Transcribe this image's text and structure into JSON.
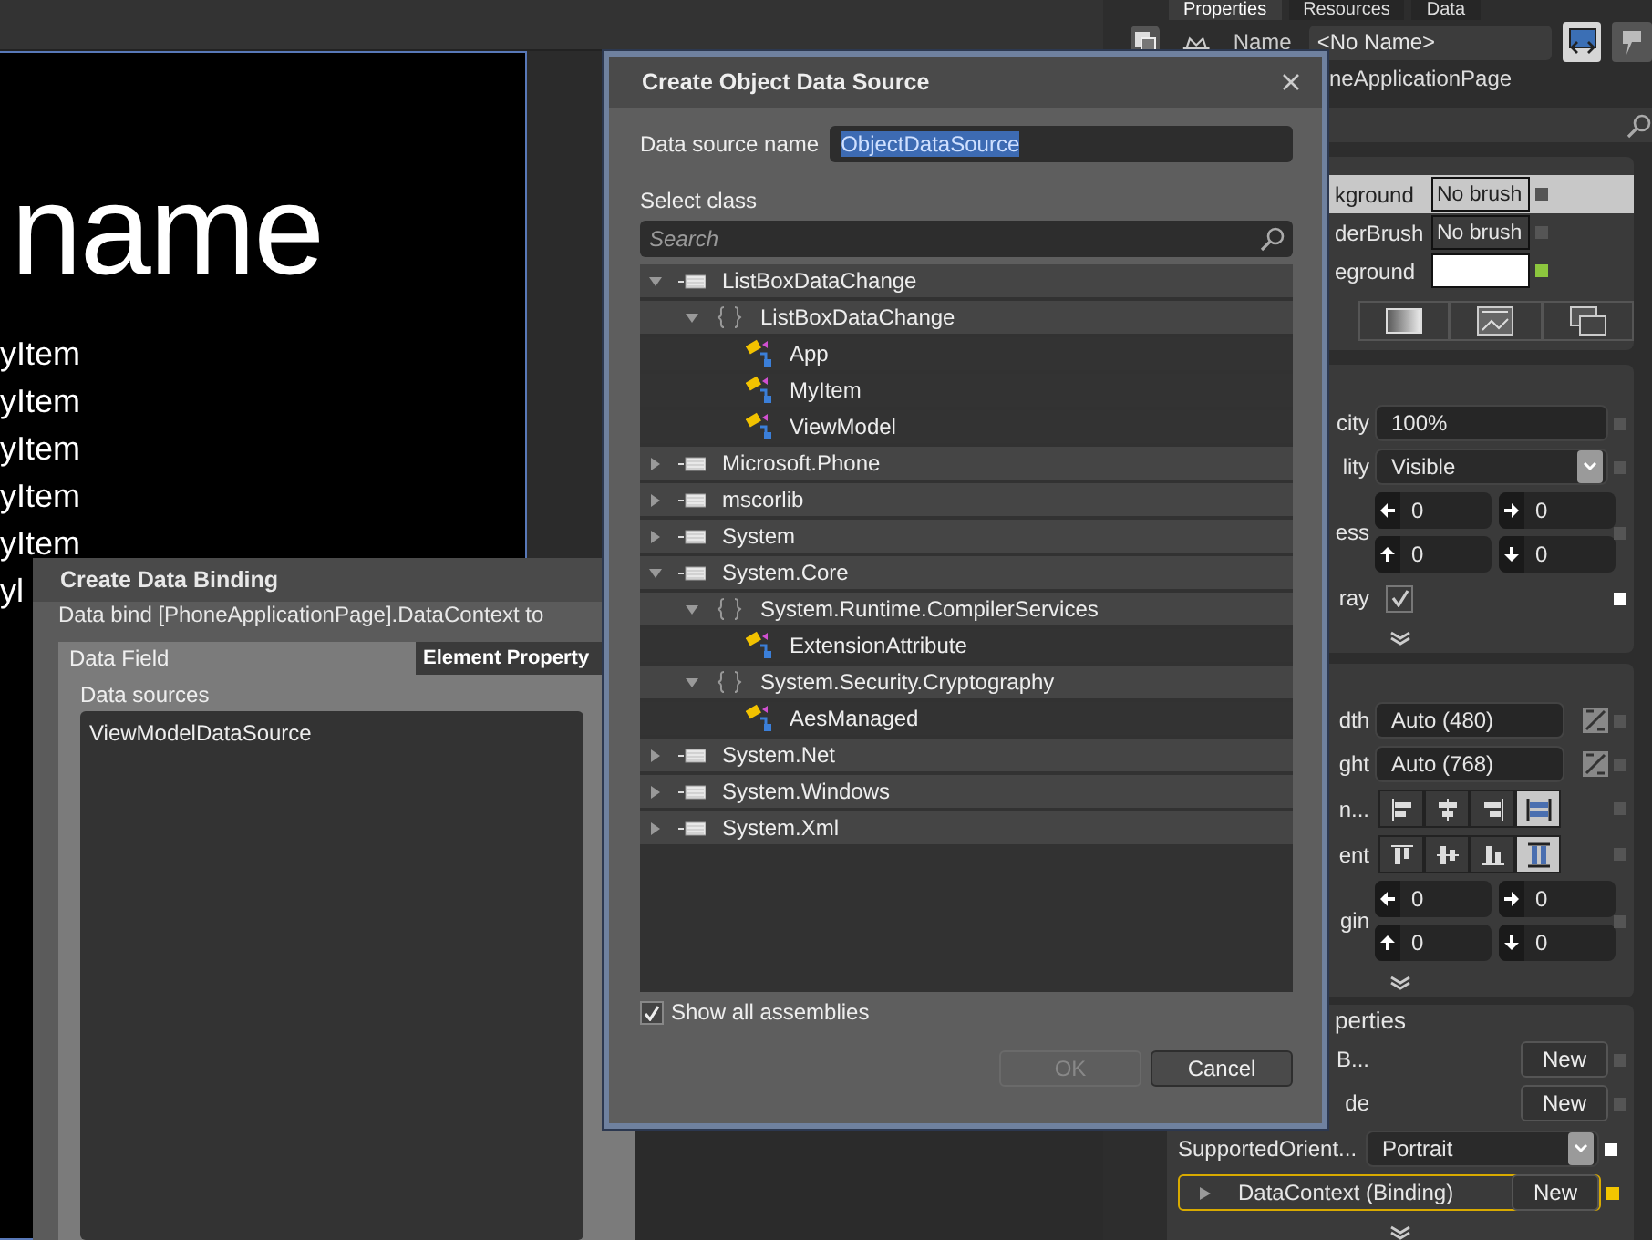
{
  "artboard": {
    "title": "name",
    "items": [
      "yItem",
      "yItem",
      "yItem",
      "yItem",
      "yItem",
      "yl"
    ]
  },
  "data_binding_dialog": {
    "title": "Create Data Binding",
    "description": "Data bind [PhoneApplicationPage].DataContext to",
    "tabs": [
      {
        "label": "Data Field",
        "selected": true
      },
      {
        "label": "Element Property",
        "selected": false
      }
    ],
    "sources_label": "Data sources",
    "sources": [
      "ViewModelDataSource"
    ]
  },
  "object_data_source_dialog": {
    "title": "Create Object Data Source",
    "name_label": "Data source name",
    "name_value": "ObjectDataSource",
    "select_label": "Select class",
    "search": {
      "placeholder": "Search"
    },
    "tree": [
      {
        "label": "ListBoxDataChange",
        "kind": "assembly",
        "expanded": true,
        "selected": false,
        "children": [
          {
            "label": "ListBoxDataChange",
            "kind": "namespace",
            "expanded": true,
            "selected": false,
            "children": [
              {
                "label": "App",
                "kind": "class",
                "selected": false
              },
              {
                "label": "MyItem",
                "kind": "class",
                "selected": false
              },
              {
                "label": "ViewModel",
                "kind": "class",
                "selected": false
              }
            ]
          }
        ]
      },
      {
        "label": "Microsoft.Phone",
        "kind": "assembly",
        "expanded": false,
        "selected": false
      },
      {
        "label": "mscorlib",
        "kind": "assembly",
        "expanded": false,
        "selected": false
      },
      {
        "label": "System",
        "kind": "assembly",
        "expanded": false,
        "selected": false
      },
      {
        "label": "System.Core",
        "kind": "assembly",
        "expanded": true,
        "selected": false,
        "children": [
          {
            "label": "System.Runtime.CompilerServices",
            "kind": "namespace",
            "expanded": true,
            "selected": false,
            "children": [
              {
                "label": "ExtensionAttribute",
                "kind": "class",
                "selected": false
              }
            ]
          },
          {
            "label": "System.Security.Cryptography",
            "kind": "namespace",
            "expanded": true,
            "selected": false,
            "children": [
              {
                "label": "AesManaged",
                "kind": "class",
                "selected": false
              }
            ]
          }
        ]
      },
      {
        "label": "System.Net",
        "kind": "assembly",
        "expanded": false,
        "selected": false
      },
      {
        "label": "System.Windows",
        "kind": "assembly",
        "expanded": false,
        "selected": false
      },
      {
        "label": "System.Xml",
        "kind": "assembly",
        "expanded": false,
        "selected": false
      }
    ],
    "show_all": {
      "label": "Show all assemblies",
      "checked": true
    },
    "buttons": [
      {
        "label": "OK",
        "disabled": true
      },
      {
        "label": "Cancel",
        "disabled": false
      }
    ]
  },
  "properties_panel": {
    "tabs": [
      {
        "label": "Properties",
        "selected": true
      },
      {
        "label": "Resources",
        "selected": false
      },
      {
        "label": "Data",
        "selected": false
      }
    ],
    "name_label": "Name",
    "name_value": "<No Name>",
    "type_name": "neApplicationPage",
    "brushes": [
      {
        "label": "kground",
        "kind": "none",
        "value": "No brush",
        "selected": true,
        "marker": {
          "color": "#555555"
        }
      },
      {
        "label": "derBrush",
        "kind": "none",
        "value": "No brush",
        "selected": false,
        "marker": {
          "color": "#555555"
        }
      },
      {
        "label": "eground",
        "kind": "solid",
        "color": "#ffffff",
        "selected": false,
        "marker": {
          "color": "#8cc63e"
        }
      }
    ],
    "appearance": [
      {
        "kind": "text",
        "label": "city",
        "value": "100%",
        "marker": {
          "color": "#555555"
        }
      },
      {
        "kind": "dropdown",
        "label": "lity",
        "value": "Visible",
        "marker": {
          "color": "#555555"
        }
      },
      {
        "kind": "quad",
        "label": "ess",
        "values": [
          "0",
          "0",
          "0",
          "0"
        ],
        "marker": {
          "color": "#555555"
        }
      },
      {
        "kind": "check",
        "label": "ray",
        "checked": true,
        "marker": {
          "color": "#ffffff"
        }
      }
    ],
    "layout": [
      {
        "kind": "auto",
        "label": "dth",
        "value": "Auto (480)",
        "marker": {
          "color": "#555555"
        }
      },
      {
        "kind": "auto",
        "label": "ght",
        "value": "Auto (768)",
        "marker": {
          "color": "#555555"
        }
      },
      {
        "kind": "halign",
        "label": "n...",
        "options": [
          {
            "selected": false
          },
          {
            "selected": false
          },
          {
            "selected": false
          },
          {
            "selected": true
          }
        ],
        "marker": {
          "color": "#555555"
        }
      },
      {
        "kind": "valign",
        "label": "ent",
        "options": [
          {
            "selected": false
          },
          {
            "selected": false
          },
          {
            "selected": false
          },
          {
            "selected": true
          }
        ],
        "marker": {
          "color": "#555555"
        }
      },
      {
        "kind": "quad",
        "label": "gin",
        "values": [
          "0",
          "0",
          "0",
          "0"
        ],
        "marker": {
          "color": "#555555"
        }
      }
    ],
    "common": {
      "title": "perties",
      "rows": [
        {
          "kind": "button",
          "label": "B...",
          "value": "New",
          "marker": {
            "color": "#555555"
          }
        },
        {
          "kind": "button",
          "label": "de",
          "value": "New",
          "marker": {
            "color": "#555555"
          }
        },
        {
          "kind": "dropdown",
          "label": "SupportedOrient...",
          "value": "Portrait",
          "marker": {
            "color": "#ffffff"
          }
        },
        {
          "kind": "binding",
          "label": "DataContext (Binding)",
          "value": "New",
          "marker": {
            "color": "#f2c500"
          }
        }
      ]
    }
  }
}
